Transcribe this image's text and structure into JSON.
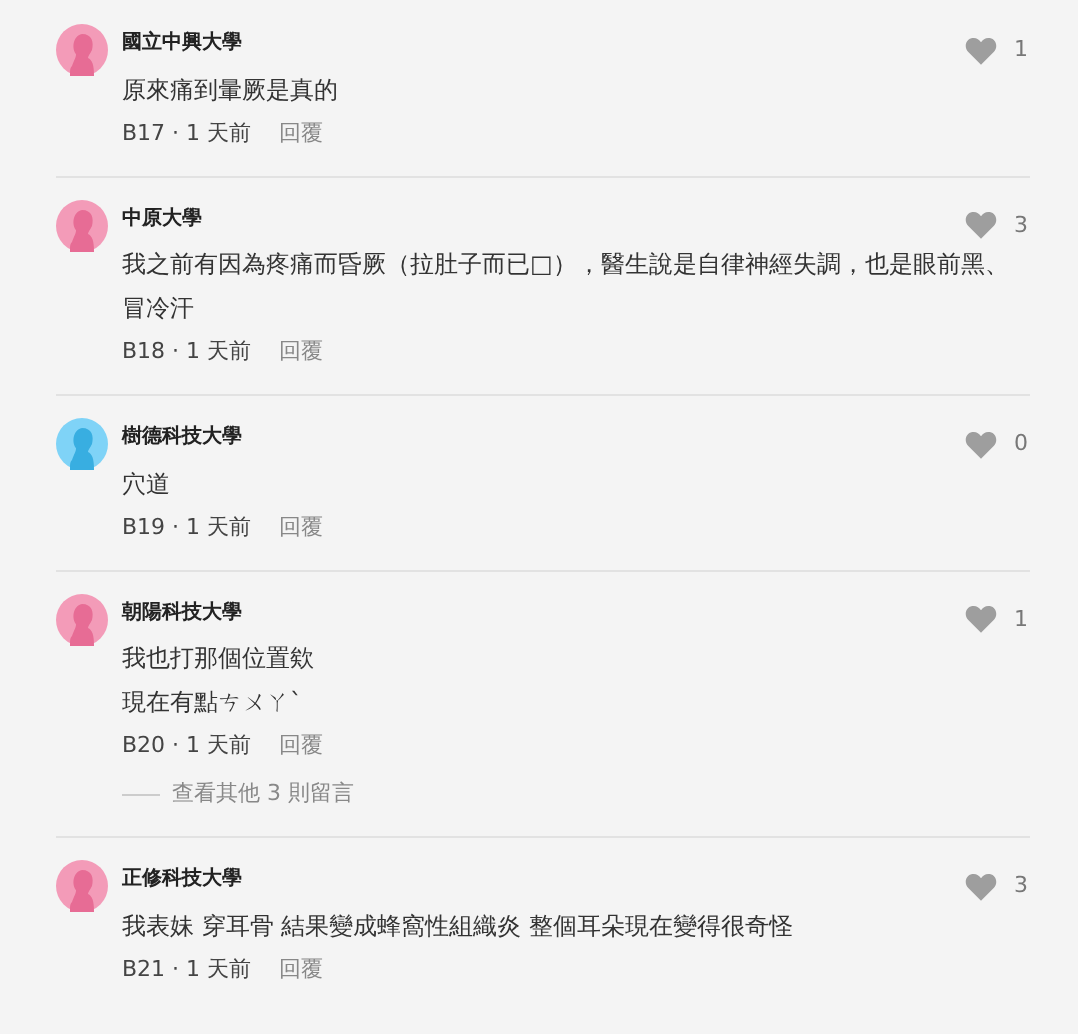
{
  "comments": [
    {
      "author": "國立中興大學",
      "avatar": {
        "color": "#f39bb8"
      },
      "likes": "1",
      "body": [
        "原來痛到暈厥是真的"
      ],
      "meta": "B17 · 1 天前",
      "reply": "回覆"
    },
    {
      "author": "中原大學",
      "avatar": {
        "color": "#f39bb8"
      },
      "likes": "3",
      "body": [
        "我之前有因為疼痛而昏厥（拉肚子而已□），醫生說是自律神經失調，也是眼前黑、冒冷汗"
      ],
      "meta": "B18 · 1 天前",
      "reply": "回覆"
    },
    {
      "author": "樹德科技大學",
      "avatar": {
        "color": "#7fd3f7"
      },
      "likes": "0",
      "body": [
        "穴道"
      ],
      "meta": "B19 · 1 天前",
      "reply": "回覆"
    },
    {
      "author": "朝陽科技大學",
      "avatar": {
        "color": "#f39bb8"
      },
      "likes": "1",
      "body": [
        "我也打那個位置欸",
        "現在有點ㄘㄨㄚˋ"
      ],
      "meta": "B20 · 1 天前",
      "reply": "回覆",
      "more_replies": "查看其他 3 則留言"
    },
    {
      "author": "正修科技大學",
      "avatar": {
        "color": "#f39bb8"
      },
      "likes": "3",
      "body": [
        "我表妹 穿耳骨 結果變成蜂窩性組織炎 整個耳朵現在變得很奇怪"
      ],
      "meta": "B21 · 1 天前",
      "reply": "回覆"
    }
  ]
}
